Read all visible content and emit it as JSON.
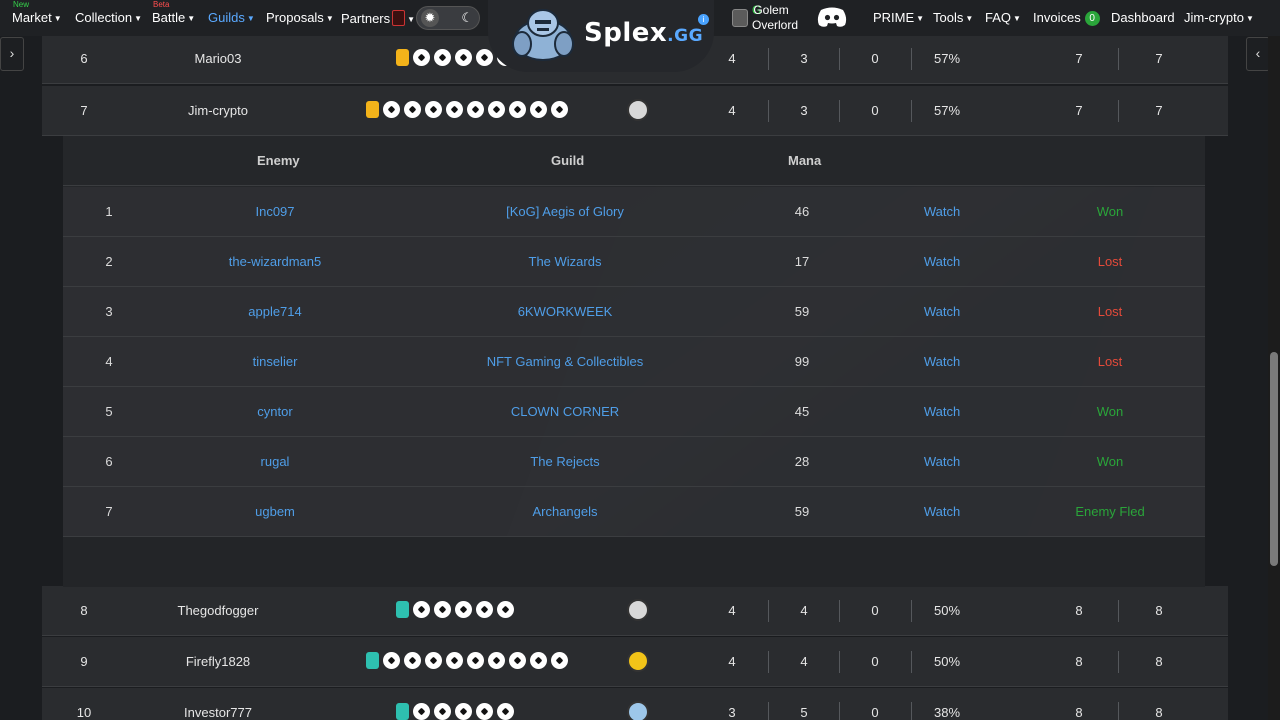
{
  "nav": {
    "market": "Market",
    "market_tag": "New",
    "collection": "Collection",
    "battle": "Battle",
    "battle_tag": "Beta",
    "guilds": "Guilds",
    "proposals": "Proposals",
    "partners": "Partners",
    "golem_line1": "Golem",
    "golem_line2": "Overlord",
    "prime": "PRIME",
    "tools": "Tools",
    "faq": "FAQ",
    "invoices": "Invoices",
    "invoices_count": "0",
    "dashboard": "Dashboard",
    "user": "Jim-crypto"
  },
  "logo": {
    "text": "Splex",
    "suffix": ".GG",
    "info": "i"
  },
  "side": {
    "left_arrow": "›",
    "right_arrow": "‹"
  },
  "players": [
    {
      "rank": "6",
      "name": "Mario03",
      "c1": "4",
      "c2": "3",
      "c3": "0",
      "pct": "57%",
      "c4": "7",
      "c5": "7"
    },
    {
      "rank": "7",
      "name": "Jim-crypto",
      "c1": "4",
      "c2": "3",
      "c3": "0",
      "pct": "57%",
      "c4": "7",
      "c5": "7"
    },
    {
      "rank": "8",
      "name": "Thegodfogger",
      "c1": "4",
      "c2": "4",
      "c3": "0",
      "pct": "50%",
      "c4": "8",
      "c5": "8"
    },
    {
      "rank": "9",
      "name": "Firefly1828",
      "c1": "4",
      "c2": "4",
      "c3": "0",
      "pct": "50%",
      "c4": "8",
      "c5": "8"
    },
    {
      "rank": "10",
      "name": "Investor777",
      "c1": "3",
      "c2": "5",
      "c3": "0",
      "pct": "38%",
      "c4": "8",
      "c5": "8"
    }
  ],
  "battles": {
    "headers": {
      "enemy": "Enemy",
      "guild": "Guild",
      "mana": "Mana"
    },
    "rows": [
      {
        "n": "1",
        "enemy": "Inc097",
        "guild": "[KoG] Aegis of Glory",
        "mana": "46",
        "watch": "Watch",
        "result": "Won"
      },
      {
        "n": "2",
        "enemy": "the-wizardman5",
        "guild": "The Wizards",
        "mana": "17",
        "watch": "Watch",
        "result": "Lost"
      },
      {
        "n": "3",
        "enemy": "apple714",
        "guild": "6KWORKWEEK",
        "mana": "59",
        "watch": "Watch",
        "result": "Lost"
      },
      {
        "n": "4",
        "enemy": "tinselier",
        "guild": "NFT Gaming & Collectibles",
        "mana": "99",
        "watch": "Watch",
        "result": "Lost"
      },
      {
        "n": "5",
        "enemy": "cyntor",
        "guild": "CLOWN CORNER",
        "mana": "45",
        "watch": "Watch",
        "result": "Won"
      },
      {
        "n": "6",
        "enemy": "rugal",
        "guild": "The Rejects",
        "mana": "28",
        "watch": "Watch",
        "result": "Won"
      },
      {
        "n": "7",
        "enemy": "ugbem",
        "guild": "Archangels",
        "mana": "59",
        "watch": "Watch",
        "result": "Enemy Fled"
      }
    ]
  },
  "colors": {
    "link": "#4f9ee8",
    "won": "#2aa53a",
    "lost": "#e44a3a",
    "accent": "#5aa9ff"
  }
}
